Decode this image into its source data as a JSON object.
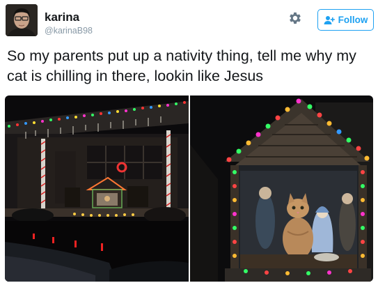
{
  "user": {
    "display_name": "karina",
    "handle": "@karinaB98",
    "avatar_icon": "avatar-photo"
  },
  "actions": {
    "settings_icon": "gear-icon",
    "follow_label": "Follow",
    "follow_icon": "add-person-icon"
  },
  "tweet": {
    "text": "So my parents put up a nativity thing, tell me why my cat is chilling in there, lookin like Jesus"
  },
  "media": {
    "photos": [
      {
        "icon": "photo-house-lights"
      },
      {
        "icon": "photo-nativity-cat"
      }
    ]
  },
  "colors": {
    "accent": "#1da1f2",
    "text": "#14171a",
    "muted": "#8899a6"
  }
}
